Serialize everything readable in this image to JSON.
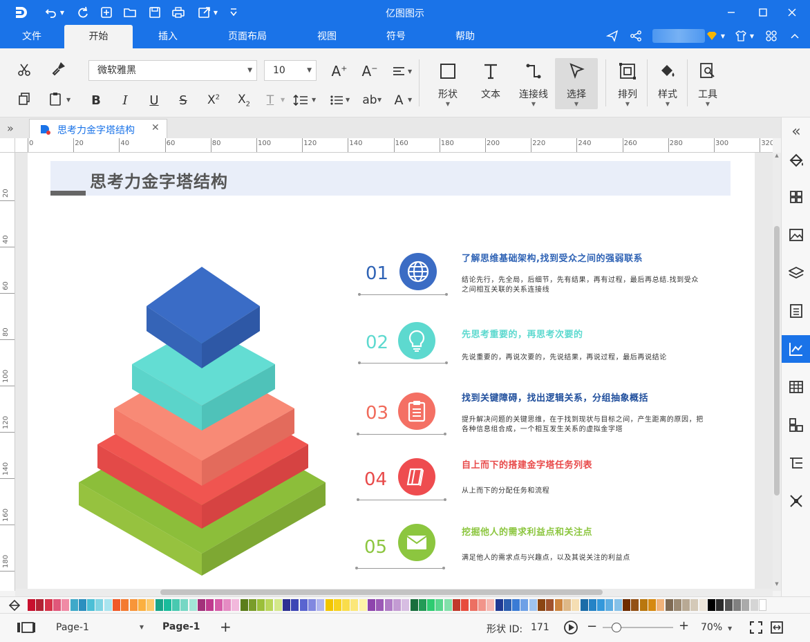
{
  "app": {
    "title": "亿图图示"
  },
  "menu": {
    "tabs": [
      "文件",
      "开始",
      "插入",
      "页面布局",
      "视图",
      "符号",
      "帮助"
    ],
    "active": "开始"
  },
  "ribbon": {
    "font_family": "微软雅黑",
    "font_size": "10",
    "big_buttons": [
      "形状",
      "文本",
      "连接线",
      "选择",
      "排列",
      "样式",
      "工具"
    ]
  },
  "document": {
    "tab_title": "思考力金字塔结构"
  },
  "rulers": {
    "horizontal": [
      "0",
      "20",
      "40",
      "60",
      "80",
      "100",
      "120",
      "140",
      "160",
      "180",
      "200",
      "220",
      "240",
      "260",
      "280",
      "300",
      "320"
    ],
    "vertical": [
      "20",
      "40",
      "60",
      "80",
      "100",
      "120",
      "140",
      "160",
      "180"
    ]
  },
  "diagram": {
    "title": "思考力金字塔结构",
    "items": [
      {
        "num": "01",
        "title": "了解思维基础架构,找到受众之间的强弱联系",
        "desc": "结论先行，先全局，后细节，先有结果，再有过程，最后再总结.找到受众之间相互关联的关系连接线",
        "color": "#2f63b5",
        "circle": "#3b6cc4",
        "icon": "globe-icon"
      },
      {
        "num": "02",
        "title": "先思考重要的，再思考次要的",
        "desc": "先说重要的，再说次要的，先说结果，再说过程，最后再说结论",
        "color": "#5dd9cf",
        "circle": "#5dd9cf",
        "icon": "lightbulb-icon"
      },
      {
        "num": "03",
        "title": "找到关键障碍，找出逻辑关系，分组抽象概括",
        "desc": "提升解决问题的关键思维，在于找到现状与目标之间，产生距离的原因，把各种信息组合成，一个相互发生关系的虚拟金字塔",
        "color": "#1f4e9c",
        "circle": "#f47064",
        "numcolor": "#f06a5a",
        "icon": "clipboard-icon"
      },
      {
        "num": "04",
        "title": "自上而下的搭建金字塔任务列表",
        "desc": "从上而下的分配任务和流程",
        "color": "#e84a4a",
        "circle": "#ee4c4f",
        "icon": "book-icon"
      },
      {
        "num": "05",
        "title": "挖掘他人的需求利益点和关注点",
        "desc": "满足他人的需求点与兴趣点，以及其说关注的利益点",
        "color": "#8cc63f",
        "circle": "#8cc63f",
        "icon": "envelope-icon"
      }
    ]
  },
  "status": {
    "page_selector": "Page-1",
    "page_tab": "Page-1",
    "shape_id_label": "形状 ID:",
    "shape_id": "171",
    "zoom": "70%"
  },
  "palette": [
    "#c8102e",
    "#b22234",
    "#d6334a",
    "#e0577a",
    "#f08aa5",
    "#3fa9c9",
    "#2b8fbf",
    "#4bbfd6",
    "#7fd4e3",
    "#a8e4ef",
    "#f05a28",
    "#f47a30",
    "#f8953a",
    "#fbb040",
    "#fcc96b",
    "#17a589",
    "#1abc9c",
    "#48c9b0",
    "#76d7c4",
    "#a3e4d7",
    "#a3307a",
    "#c0398e",
    "#d65ca8",
    "#e58bc3",
    "#f2b8dc",
    "#5b7d1a",
    "#7a9d2a",
    "#9bbf3a",
    "#b9d65a",
    "#d4e88a",
    "#2e3192",
    "#3d45b5",
    "#5a64d0",
    "#8188e0",
    "#b0b5ee",
    "#f2c500",
    "#f7d21e",
    "#f9dd4b",
    "#fbe779",
    "#fdf2a8",
    "#8e44ad",
    "#9b59b6",
    "#b07cc6",
    "#c39bd3",
    "#d7bde2",
    "#196f3d",
    "#239b56",
    "#2ecc71",
    "#58d68d",
    "#82e0aa",
    "#c0392b",
    "#e74c3c",
    "#ec7063",
    "#f1948a",
    "#f5b7b1",
    "#1f3a93",
    "#2c5eb0",
    "#3a7bd5",
    "#6ea0e6",
    "#9fc3f0",
    "#8b4513",
    "#a0522d",
    "#cd853f",
    "#deb887",
    "#f5deb3",
    "#1b6ca8",
    "#2583c6",
    "#3498db",
    "#5dade2",
    "#85c1e9",
    "#6e2c00",
    "#935116",
    "#b9770e",
    "#d68910",
    "#f0b27a",
    "#7f6a53",
    "#9c8a73",
    "#b8a994",
    "#d4c9b8",
    "#ece4d8",
    "#000000",
    "#2b2b2b",
    "#555555",
    "#808080",
    "#aaaaaa",
    "#d5d5d5",
    "#ffffff"
  ]
}
